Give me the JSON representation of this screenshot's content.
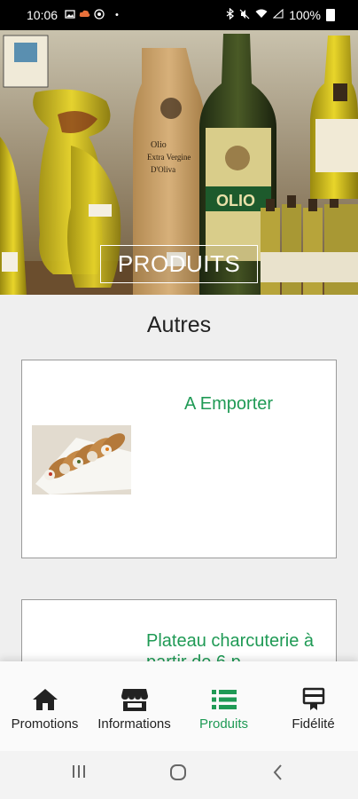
{
  "status_bar": {
    "time": "10:06",
    "battery_text": "100%",
    "icons": [
      "gallery-icon",
      "cloud-icon",
      "whatsapp-icon",
      "bluetooth-icon",
      "mute-icon",
      "wifi-icon",
      "signal-icon",
      "battery-icon"
    ]
  },
  "hero": {
    "label": "PRODUITS",
    "bottle_text": [
      "Olio",
      "Extra Vergine",
      "D'Oliva",
      "OLIO"
    ]
  },
  "section": {
    "title": "Autres"
  },
  "cards": [
    {
      "title": "A Emporter",
      "image": "cannoli-photo"
    },
    {
      "title": "Plateau charcuterie à partir de 6 p"
    }
  ],
  "bottom_nav": {
    "items": [
      {
        "label": "Promotions",
        "icon": "home-icon",
        "active": false
      },
      {
        "label": "Informations",
        "icon": "store-icon",
        "active": false
      },
      {
        "label": "Produits",
        "icon": "list-icon",
        "active": true
      },
      {
        "label": "Fidélité",
        "icon": "card-icon",
        "active": false
      }
    ],
    "active_color": "#1f9a55"
  },
  "system_nav": {
    "buttons": [
      "recent-apps-icon",
      "home-circle-icon",
      "back-icon"
    ]
  }
}
